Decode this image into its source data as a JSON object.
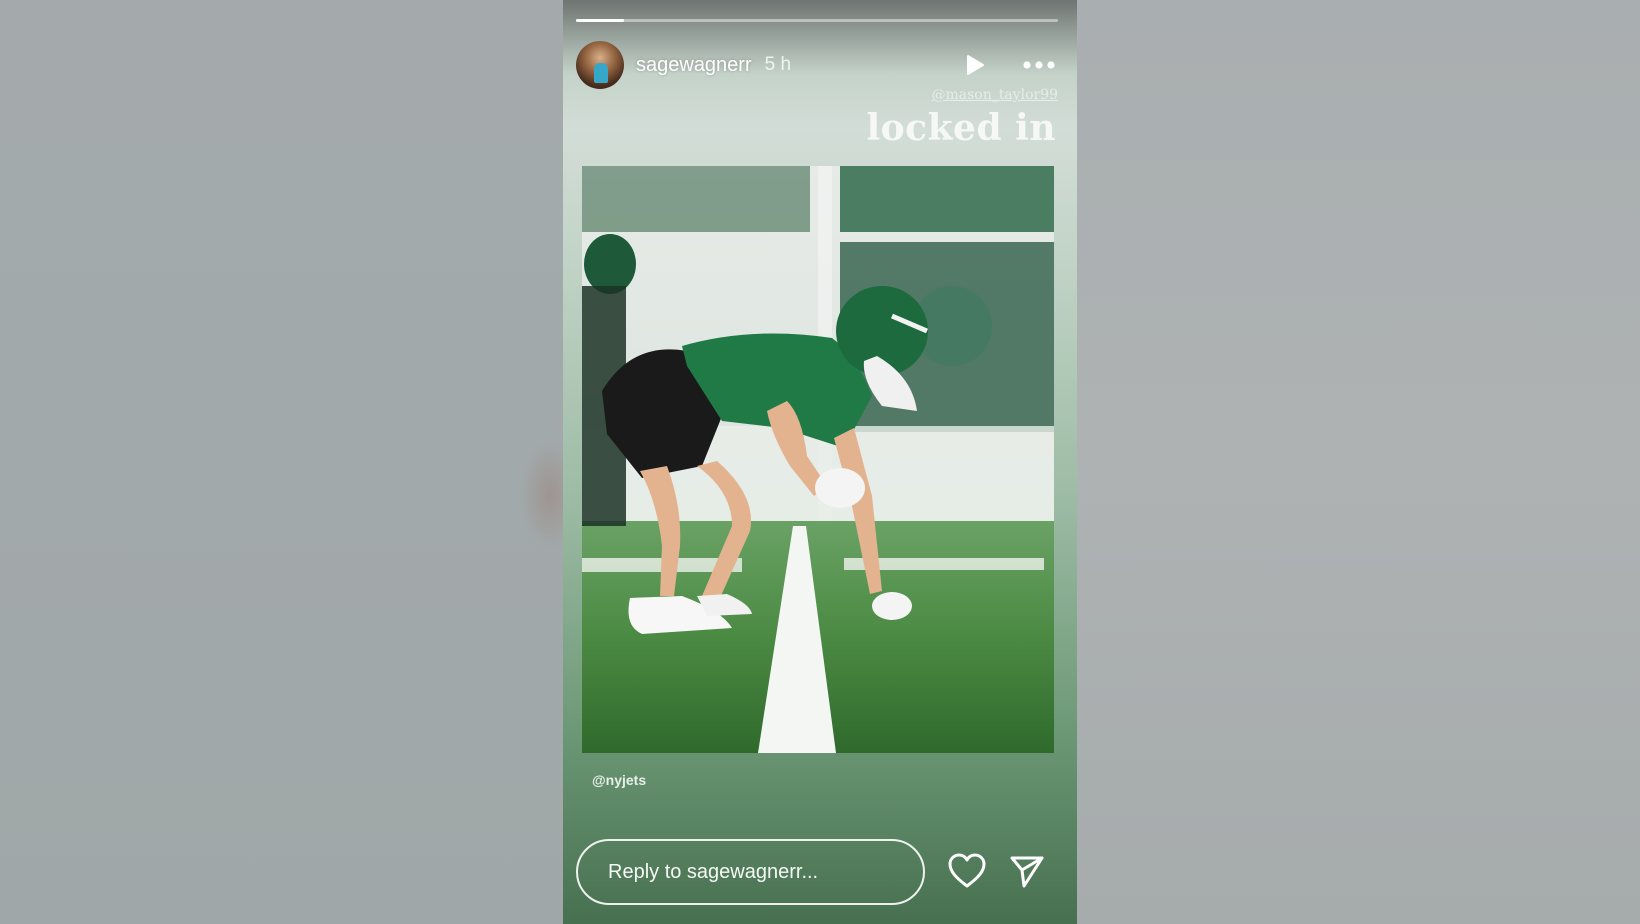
{
  "story": {
    "progress": 0.1,
    "user": {
      "username": "sagewagnerr",
      "timestamp": "5 h"
    },
    "controls": {
      "play_icon": "play-icon",
      "more_icon": "more-horizontal-icon"
    },
    "mention_tag": "@mason_taylor99",
    "caption": "locked in",
    "photo_credit_tag": "@nyjets",
    "reply": {
      "placeholder": "Reply to sagewagnerr..."
    },
    "actions": {
      "like_icon": "heart-icon",
      "share_icon": "send-icon"
    },
    "colors": {
      "jersey_green": "#1f7a45",
      "field_green": "#3f8a3c"
    }
  }
}
